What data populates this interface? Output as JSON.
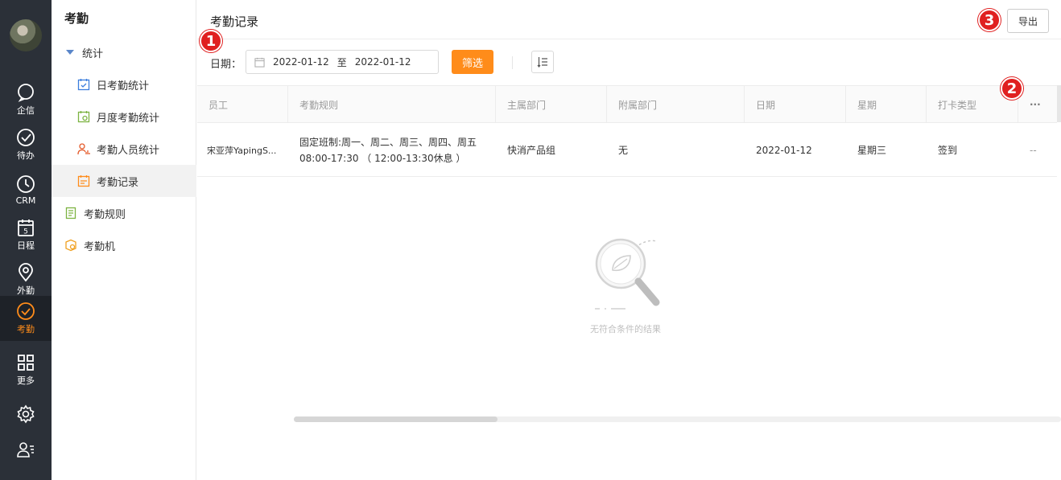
{
  "rail": {
    "items": [
      {
        "label": "企信",
        "icon": "chat-icon"
      },
      {
        "label": "待办",
        "icon": "check-circle-icon"
      },
      {
        "label": "CRM",
        "icon": "clock-icon"
      },
      {
        "label": "日程",
        "icon": "calendar-icon",
        "badge": "5"
      },
      {
        "label": "外勤",
        "icon": "location-pin-icon"
      },
      {
        "label": "考勤",
        "icon": "attendance-icon",
        "active": true
      },
      {
        "label": "更多",
        "icon": "grid-icon"
      }
    ],
    "accent_color": "#ff8c1a"
  },
  "sidebar": {
    "title": "考勤",
    "group_label": "统计",
    "items": [
      {
        "label": "日考勤统计",
        "icon": "calendar-check-icon"
      },
      {
        "label": "月度考勤统计",
        "icon": "calendar-month-icon"
      },
      {
        "label": "考勤人员统计",
        "icon": "person-stats-icon"
      },
      {
        "label": "考勤记录",
        "icon": "record-icon",
        "active": true
      },
      {
        "label": "考勤规则",
        "icon": "rule-doc-icon"
      },
      {
        "label": "考勤机",
        "icon": "machine-icon"
      }
    ]
  },
  "header": {
    "title": "考勤记录",
    "export_label": "导出"
  },
  "filters": {
    "date_label": "日期：",
    "start_date": "2022-01-12",
    "separator": "至",
    "end_date": "2022-01-12",
    "filter_label": "筛选"
  },
  "table": {
    "columns": [
      "员工",
      "考勤规则",
      "主属部门",
      "附属部门",
      "日期",
      "星期",
      "打卡类型",
      "···"
    ],
    "rows": [
      {
        "employee": "宋亚萍YapingS...",
        "rule_line1": "固定班制:周一、周二、周三、周四、周五",
        "rule_line2": "08:00-17:30 （ 12:00-13:30休息 ）",
        "main_dept": "快消产品组",
        "sub_dept": "无",
        "date": "2022-01-12",
        "weekday": "星期三",
        "punch_type": "签到",
        "more": "--"
      }
    ]
  },
  "empty": {
    "text": "无符合条件的结果"
  },
  "annotations": {
    "one": "1",
    "two": "2",
    "three": "3",
    "color": "#e02020"
  }
}
